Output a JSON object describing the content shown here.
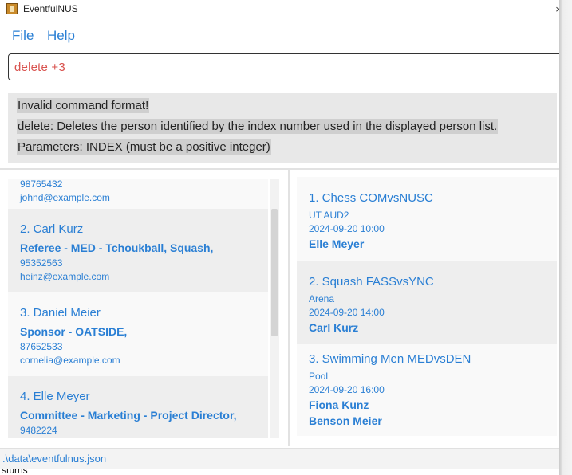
{
  "window": {
    "title": "EventfulNUS",
    "controls": {
      "minimize": "—",
      "maximize": "",
      "close": "×"
    }
  },
  "menu": {
    "file": "File",
    "help": "Help"
  },
  "command": {
    "value": "delete +3"
  },
  "result": {
    "lines": [
      "Invalid command format!",
      "delete: Deletes the person identified by the index number used in the displayed person list.",
      "Parameters: INDEX (must be a positive integer)"
    ]
  },
  "persons": [
    {
      "phone": "98765432",
      "email": "johnd@example.com"
    },
    {
      "name": "2. Carl Kurz",
      "role": "Referee - MED - Tchoukball, Squash,",
      "phone": "95352563",
      "email": "heinz@example.com"
    },
    {
      "name": "3. Daniel Meier",
      "role": "Sponsor - OATSIDE,",
      "phone": "87652533",
      "email": "cornelia@example.com"
    },
    {
      "name": "4. Elle Meyer",
      "role": "Committee - Marketing - Project Director,",
      "phone": "9482224"
    }
  ],
  "events": [
    {
      "name": "1. Chess COMvsNUSC",
      "venue": "UT AUD2",
      "datetime": "2024-09-20 10:00",
      "participants": [
        "Elle Meyer"
      ]
    },
    {
      "name": "2. Squash FASSvsYNC",
      "venue": "Arena",
      "datetime": "2024-09-20 14:00",
      "participants": [
        "Carl Kurz"
      ]
    },
    {
      "name": "3. Swimming Men MEDvsDEN",
      "venue": "Pool",
      "datetime": "2024-09-20 16:00",
      "participants": [
        "Fiona Kunz",
        "Benson Meier"
      ]
    }
  ],
  "status": {
    "file_path": ".\\data\\eventfulnus.json"
  },
  "bottom_peek": "sturns",
  "colors": {
    "accent": "#2a7fd4",
    "error": "#d9534f"
  }
}
